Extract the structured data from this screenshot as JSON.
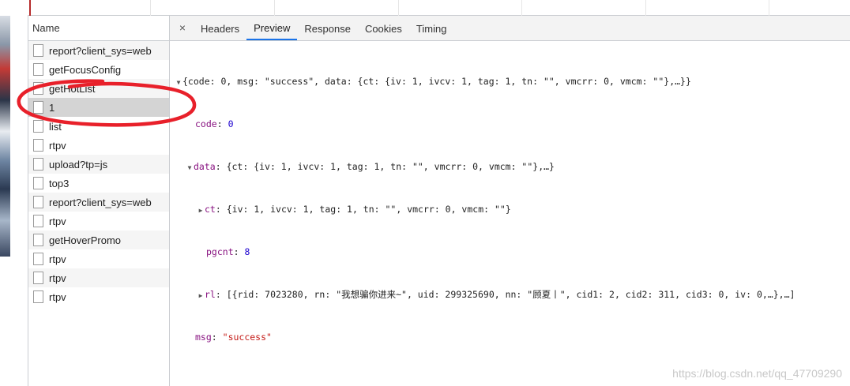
{
  "name_panel": {
    "header": "Name",
    "requests": [
      {
        "name": "report?client_sys=web",
        "alt": true,
        "selected": false
      },
      {
        "name": "getFocusConfig",
        "alt": false,
        "selected": false
      },
      {
        "name": "getHotList",
        "alt": true,
        "selected": false
      },
      {
        "name": "1",
        "alt": false,
        "selected": true
      },
      {
        "name": "list",
        "alt": false,
        "selected": false
      },
      {
        "name": "rtpv",
        "alt": false,
        "selected": false
      },
      {
        "name": "upload?tp=js",
        "alt": true,
        "selected": false
      },
      {
        "name": "top3",
        "alt": false,
        "selected": false
      },
      {
        "name": "report?client_sys=web",
        "alt": true,
        "selected": false
      },
      {
        "name": "rtpv",
        "alt": false,
        "selected": false
      },
      {
        "name": "getHoverPromo",
        "alt": true,
        "selected": false
      },
      {
        "name": "rtpv",
        "alt": false,
        "selected": false
      },
      {
        "name": "rtpv",
        "alt": true,
        "selected": false
      },
      {
        "name": "rtpv",
        "alt": false,
        "selected": false
      }
    ]
  },
  "tabs": {
    "close": "×",
    "items": [
      "Headers",
      "Preview",
      "Response",
      "Cookies",
      "Timing"
    ],
    "active": "Preview"
  },
  "preview": {
    "root": "{code: 0, msg: \"success\", data: {ct: {iv: 1, ivcv: 1, tag: 1, tn: \"\", vmcrr: 0, vmcm: \"\"},…}}",
    "code_key": "code",
    "code_val": "0",
    "data_key": "data",
    "data_summary": "{ct: {iv: 1, ivcv: 1, tag: 1, tn: \"\", vmcrr: 0, vmcm: \"\"},…}",
    "ct_key": "ct",
    "ct_summary": "{iv: 1, ivcv: 1, tag: 1, tn: \"\", vmcrr: 0, vmcm: \"\"}",
    "pgcnt_key": "pgcnt",
    "pgcnt_val": "8",
    "rl_key": "rl",
    "rl_summary": "[{rid: 7023280, rn: \"我想骗你进来~\", uid: 299325690, nn: \"顾夏丨\", cid1: 2, cid2: 311, cid3: 0, iv: 0,…},…]",
    "msg_key": "msg",
    "msg_val": "\"success\""
  },
  "watermark": "https://blog.csdn.net/qq_47709290",
  "annotation_color": "#e8202a"
}
